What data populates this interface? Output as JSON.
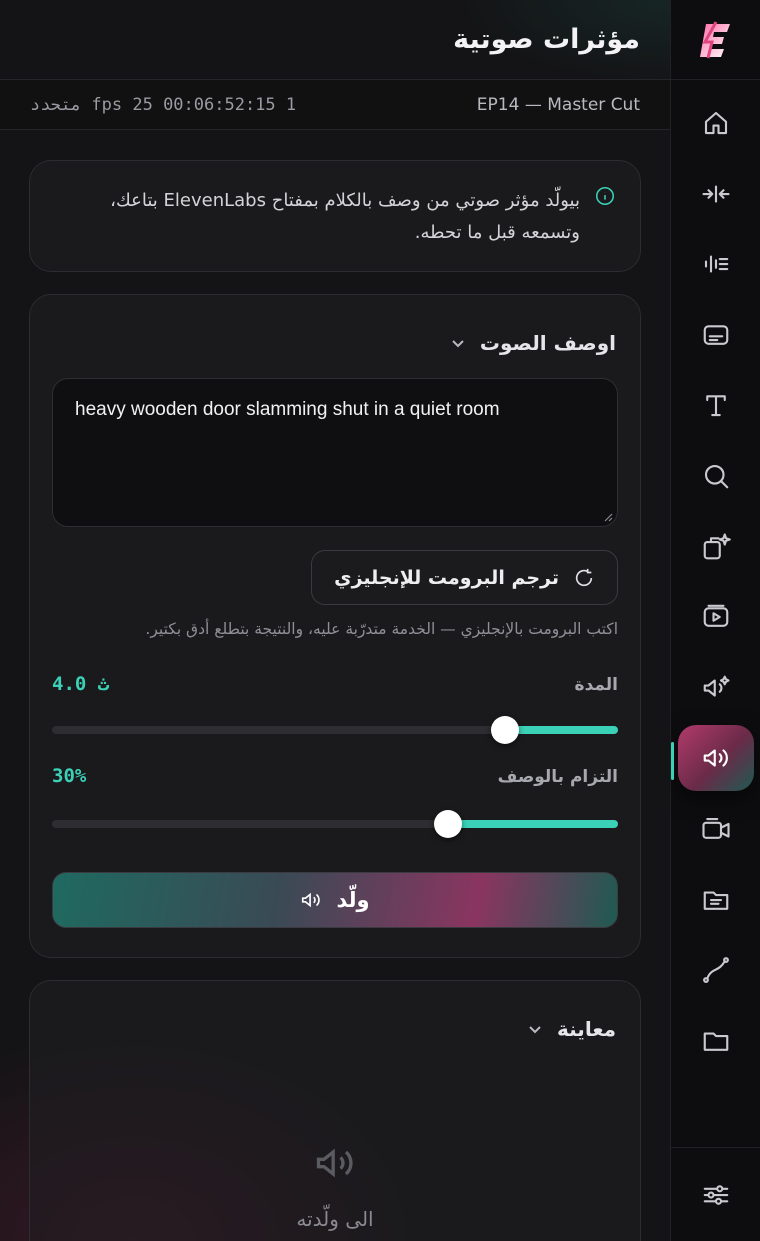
{
  "header": {
    "title": "مؤثرات صوتية"
  },
  "subbar": {
    "episode": "EP14 — Master Cut",
    "timecode": "fps 25  00:06:52:15  1 متحدد"
  },
  "info": {
    "text": "بيولّد مؤثر صوتي من وصف بالكلام بمفتاح ElevenLabs بتاعك، وتسمعه قبل ما تحطه."
  },
  "describe": {
    "heading": "اوصف الصوت",
    "prompt_value": "heavy wooden door slamming shut in a quiet room",
    "translate_label": "ترجم البرومت للإنجليزي",
    "hint": "اكتب البرومت بالإنجليزي — الخدمة متدرّبة عليه، والنتيجة بتطلع أدق بكتير.",
    "duration_label": "المدة",
    "duration_value": "4.0 ث",
    "duration_fraction": 0.2,
    "adherence_label": "التزام بالوصف",
    "adherence_value": "30%",
    "adherence_fraction": 0.3,
    "generate_label": "ولّد"
  },
  "preview": {
    "heading": "معاينة",
    "empty_text": "الى ولّدته"
  },
  "rail": {
    "items": [
      "home-icon",
      "split-icon",
      "waveform-icon",
      "subtitles-icon",
      "text-icon",
      "search-icon",
      "ai-copy-icon",
      "video-play-icon",
      "voice-ai-icon",
      "sound-effects-icon",
      "camera-icon",
      "folder-doc-icon",
      "curve-icon",
      "folder-icon"
    ],
    "active": "sound-effects-icon",
    "bottom": "settings-sliders-icon"
  },
  "colors": {
    "accent": "#3bd1b6",
    "brand_pink": "#e0457f"
  }
}
